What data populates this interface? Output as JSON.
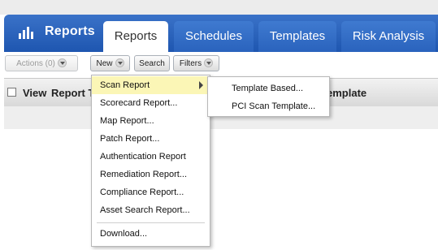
{
  "app": {
    "brand_title": "Reports",
    "brand_icon": "bar-chart-icon"
  },
  "tabs": [
    {
      "label": "Reports",
      "active": true
    },
    {
      "label": "Schedules",
      "active": false
    },
    {
      "label": "Templates",
      "active": false
    },
    {
      "label": "Risk Analysis",
      "active": false
    }
  ],
  "toolbar": {
    "actions_label": "Actions (0)",
    "new_label": "New",
    "search_label": "Search",
    "filters_label": "Filters"
  },
  "grid": {
    "columns": [
      "View",
      "Report Ti",
      "emplate"
    ]
  },
  "new_menu": {
    "items": [
      "Scan Report",
      "Scorecard Report...",
      "Map Report...",
      "Patch Report...",
      "Authentication Report",
      "Remediation Report...",
      "Compliance Report...",
      "Asset Search Report...",
      "Download..."
    ],
    "highlight_color": "#fbf6b6"
  },
  "scan_submenu": {
    "items": [
      "Template Based...",
      "PCI Scan Template..."
    ]
  },
  "colors": {
    "tab_bar": "#1e56b0",
    "tab": "#2a63bd"
  }
}
